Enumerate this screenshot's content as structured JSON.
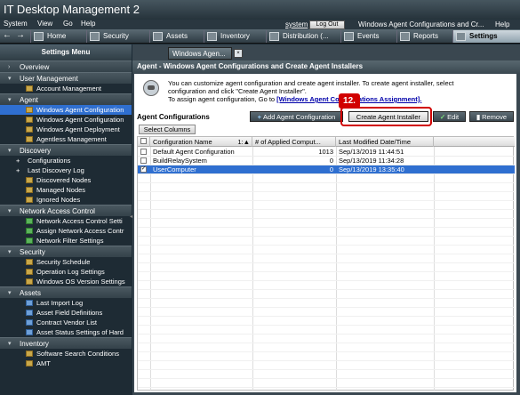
{
  "app_title": "IT Desktop Management 2",
  "menu": [
    "System",
    "View",
    "Go",
    "Help"
  ],
  "header": {
    "user_link": "system",
    "logout_label": "Log Out",
    "current_page": "Windows Agent Configurations and Cr...",
    "help_label": "Help"
  },
  "nav": {
    "back": "←",
    "forward": "→",
    "tabs": [
      "Home",
      "Security",
      "Assets",
      "Inventory",
      "Distribution (...",
      "Events",
      "Reports",
      "Settings"
    ],
    "active_tab": "Settings"
  },
  "sidebar": {
    "title": "Settings Menu",
    "overview": "Overview",
    "user_management": {
      "title": "User Management",
      "items": [
        "Account Management"
      ]
    },
    "agent": {
      "title": "Agent",
      "items": [
        "Windows Agent Configuration",
        "Windows Agent Configuration",
        "Windows Agent Deployment",
        "Agentless Management"
      ]
    },
    "discovery": {
      "title": "Discovery",
      "items": [
        "Configurations",
        "Last Discovery Log",
        "Discovered Nodes",
        "Managed Nodes",
        "Ignored Nodes"
      ]
    },
    "network_access_control": {
      "title": "Network Access Control",
      "items": [
        "Network Access Control Setti",
        "Assign Network Access Contr",
        "Network Filter Settings"
      ]
    },
    "security": {
      "title": "Security",
      "items": [
        "Security Schedule",
        "Operation Log Settings",
        "Windows OS Version Settings"
      ]
    },
    "assets": {
      "title": "Assets",
      "items": [
        "Last Import Log",
        "Asset Field Definitions",
        "Contract Vendor List",
        "Asset Status Settings of Hard"
      ]
    },
    "inventory": {
      "title": "Inventory",
      "items": [
        "Software Search Conditions",
        "AMT"
      ]
    }
  },
  "main": {
    "tab_label": "Windows Agen...",
    "tab_close": "×",
    "panel_title": "Agent - Windows Agent Configurations and Create Agent Installers",
    "info_line1": "You can customize agent configuration and create agent installer. To create agent installer, select",
    "info_line2": "configuration and click \"Create Agent Installer\".",
    "info_line3_prefix": "To assign agent configuration, Go to ",
    "info_link": "[Windows Agent Configurations Assignment].",
    "section_label": "Agent Configurations",
    "buttons": {
      "add": "Add Agent Configuration",
      "create": "Create Agent Installer",
      "edit": "Edit",
      "remove": "Remove"
    },
    "callout_number": "12.",
    "select_columns": "Select Columns",
    "columns": [
      "Configuration Name",
      "1:▲",
      "# of Applied Comput...",
      "Last Modified Date/Time"
    ],
    "rows": [
      {
        "name": "Default Agent Configuration",
        "applied": "1013",
        "modified": "Sep/13/2019 11:44:51",
        "checked": ""
      },
      {
        "name": "BuildRelaySystem",
        "applied": "0",
        "modified": "Sep/13/2019 11:34:28",
        "checked": ""
      },
      {
        "name": "UserComputer",
        "applied": "0",
        "modified": "Sep/13/2019 13:35:40",
        "checked": "✓"
      }
    ]
  },
  "colors": {
    "selection": "#2f6fd0",
    "callout": "#d10000",
    "sidebar_bg": "#1e2b34"
  }
}
